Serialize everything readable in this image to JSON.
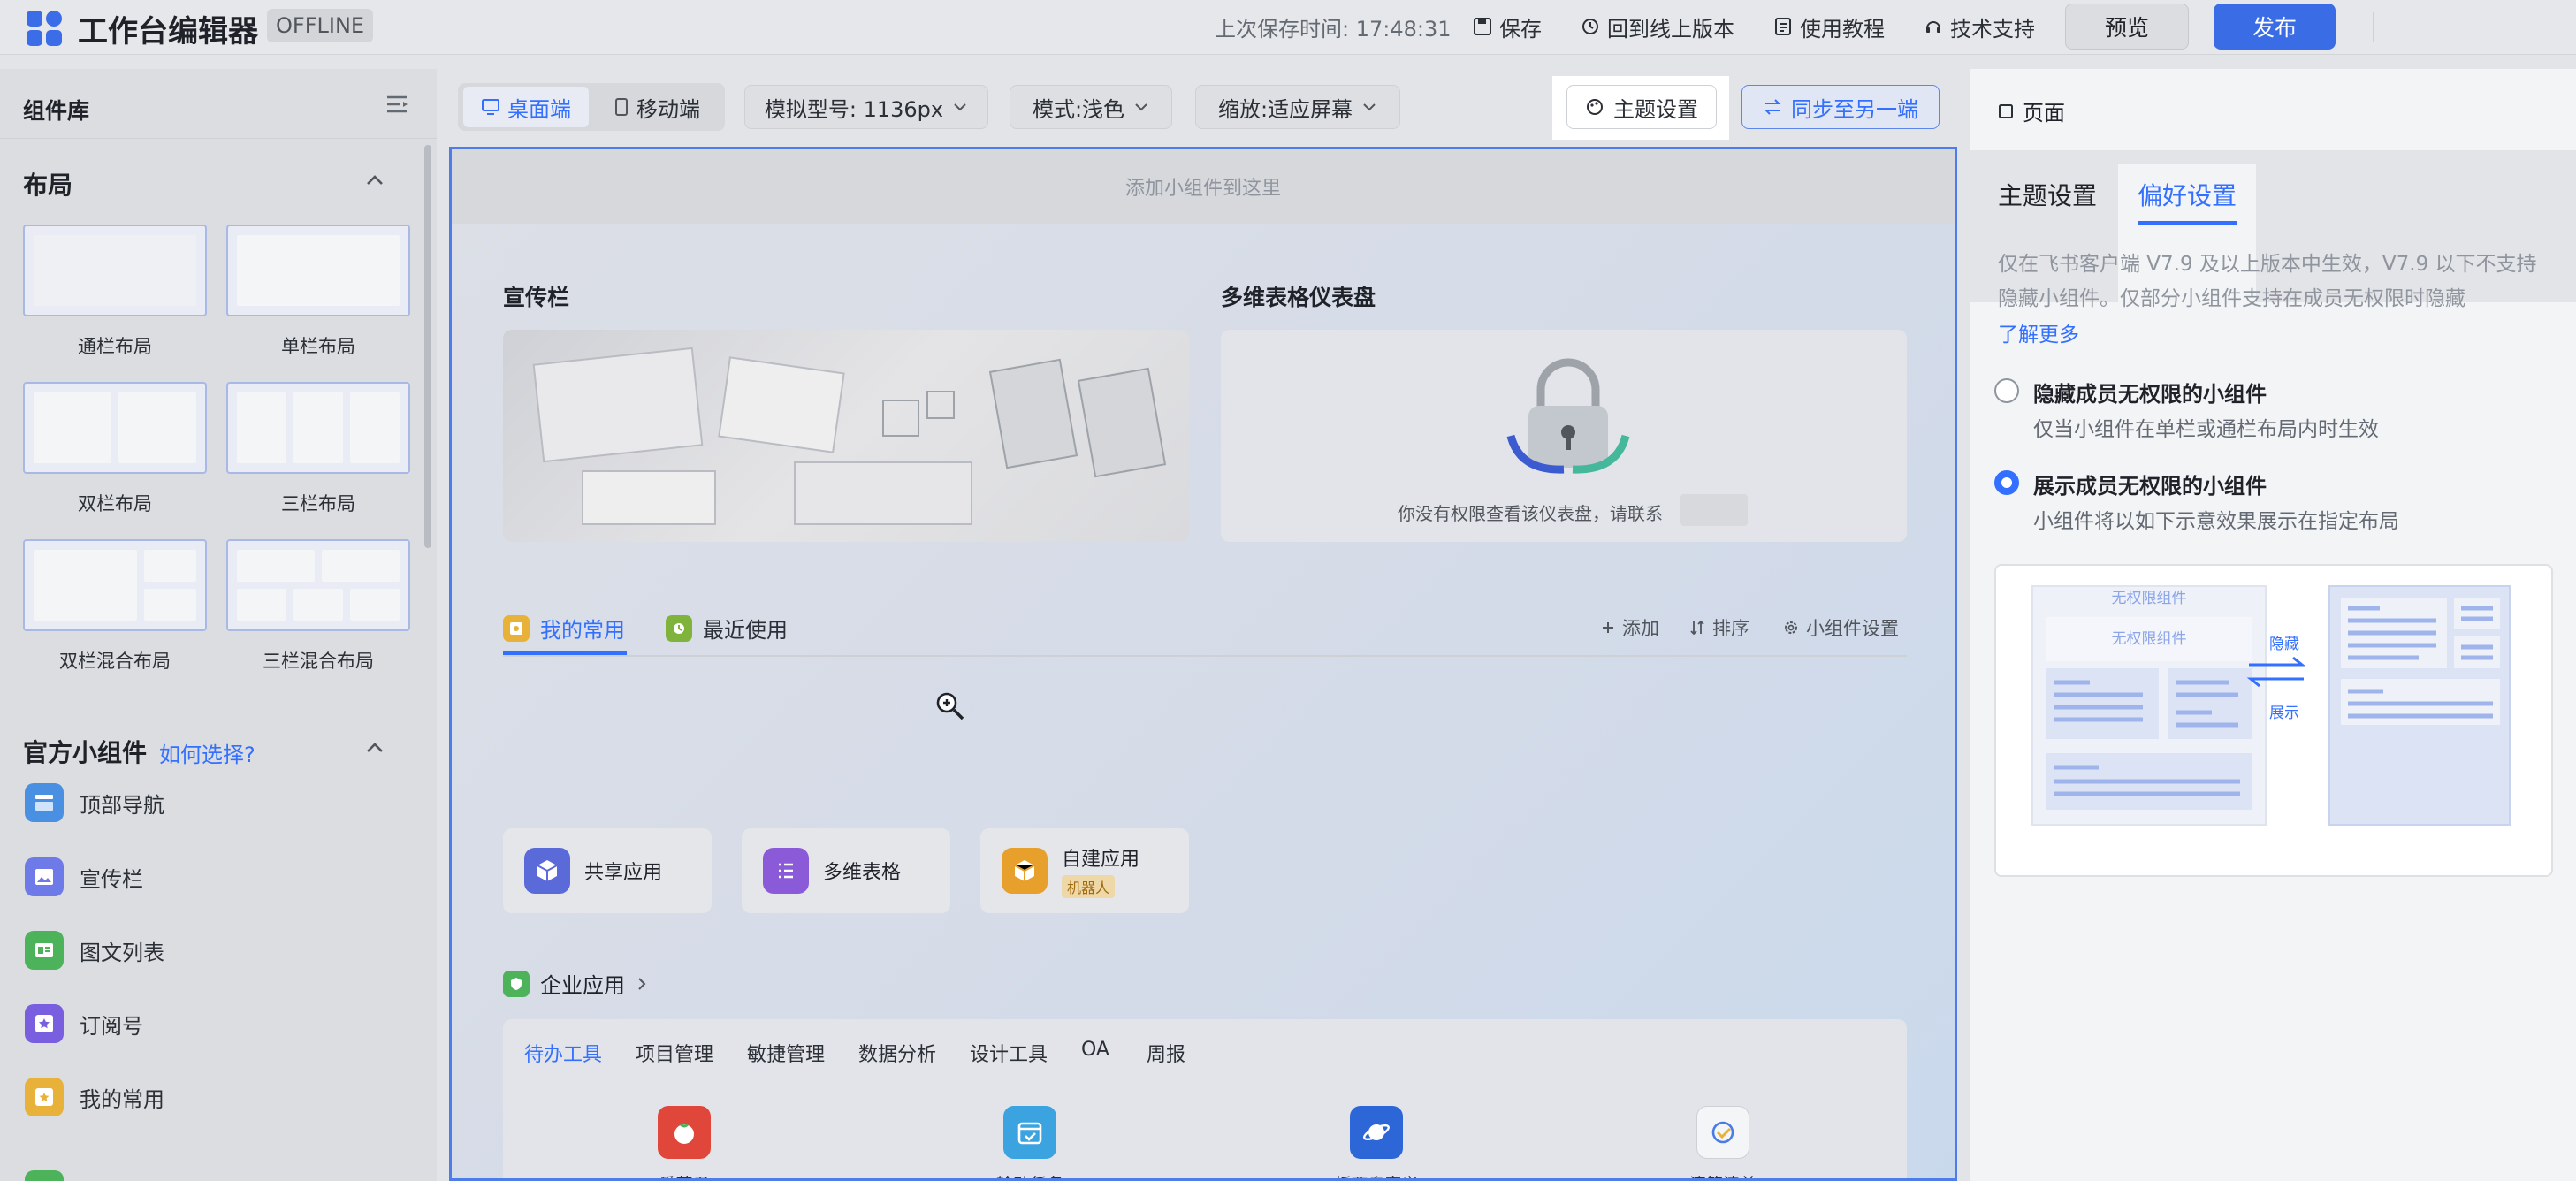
{
  "topbar": {
    "title": "工作台编辑器",
    "badge": "OFFLINE",
    "last_saved": "上次保存时间: 17:48:31",
    "save": "保存",
    "revert": "回到线上版本",
    "tutorial": "使用教程",
    "support": "技术支持",
    "preview": "预览",
    "publish": "发布"
  },
  "left": {
    "title": "组件库",
    "layout_section": "布局",
    "layouts": [
      "通栏布局",
      "单栏布局",
      "双栏布局",
      "三栏布局",
      "双栏混合布局",
      "三栏混合布局"
    ],
    "widgets_section": "官方小组件",
    "widgets_help": "如何选择?",
    "widgets": [
      "顶部导航",
      "宣传栏",
      "图文列表",
      "订阅号",
      "我的常用"
    ]
  },
  "toolbar": {
    "desktop": "桌面端",
    "mobile": "移动端",
    "model": "模拟型号: 1136px",
    "mode": "模式:浅色",
    "zoom": "缩放:适应屏幕",
    "theme": "主题设置",
    "sync": "同步至另一端"
  },
  "canvas": {
    "page_tag": "页面",
    "drop_hint": "添加小组件到这里",
    "banner_title": "宣传栏",
    "dashboard_title": "多维表格仪表盘",
    "no_permission": "你没有权限查看该仪表盘，请联系",
    "tab_common": "我的常用",
    "tab_recent": "最近使用",
    "add": "添加",
    "sort": "排序",
    "widget_settings": "小组件设置",
    "apps": [
      {
        "name": "共享应用",
        "tag": ""
      },
      {
        "name": "多维表格",
        "tag": ""
      },
      {
        "name": "自建应用",
        "tag": "机器人"
      }
    ],
    "enterprise_title": "企业应用",
    "enterprise_tabs": [
      "待办工具",
      "项目管理",
      "敏捷管理",
      "数据分析",
      "设计工具",
      "OA",
      "周报"
    ],
    "tools": [
      "番茄君",
      "轮动任务",
      "板栗自定义",
      "滴答清单"
    ]
  },
  "right": {
    "header": "页面",
    "tab_theme": "主题设置",
    "tab_pref": "偏好设置",
    "desc": "仅在飞书客户端 V7.9 及以上版本中生效，V7.9 以下不支持隐藏小组件。仅部分小组件支持在成员无权限时隐藏",
    "learn_more": "了解更多",
    "opt1_title": "隐藏成员无权限的小组件",
    "opt1_desc": "仅当小组件在单栏或通栏布局内时生效",
    "opt2_title": "展示成员无权限的小组件",
    "opt2_desc": "小组件将以如下示意效果展示在指定布局",
    "illus_label1": "无权限组件",
    "illus_label2": "无权限组件",
    "illus_hide": "隐藏",
    "illus_show": "展示"
  },
  "colors": {
    "accent": "#3370ff",
    "publish": "#3a6ce6",
    "canvas_border": "#4e7ce8"
  }
}
